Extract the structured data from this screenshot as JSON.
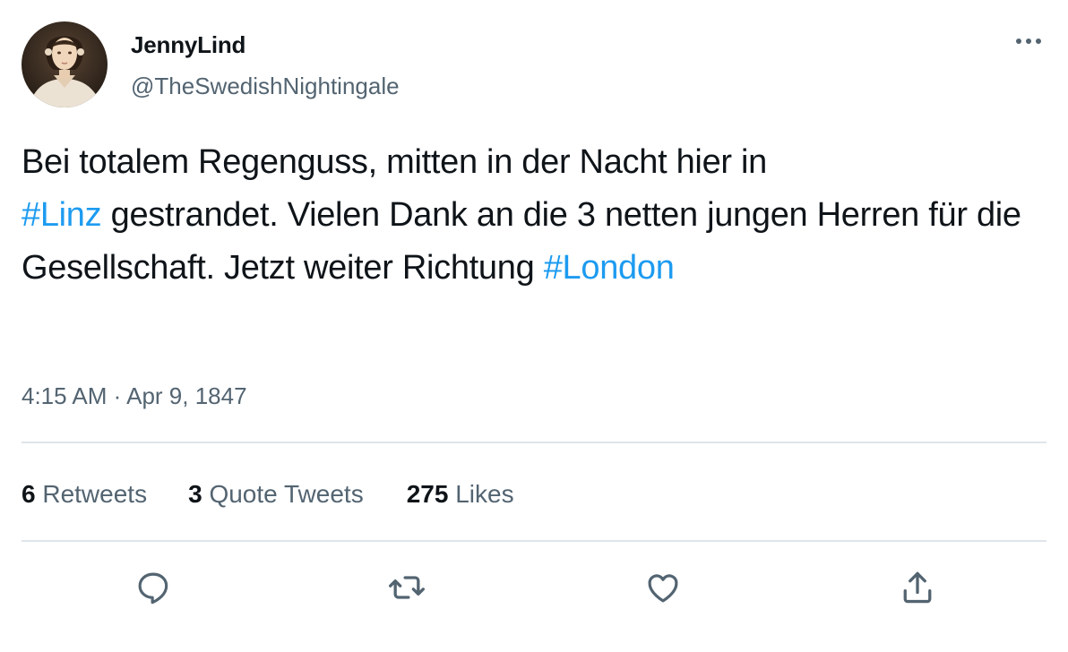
{
  "author": {
    "display_name": "JennyLind",
    "handle": "@TheSwedishNightingale",
    "avatar_icon": "portrait-avatar"
  },
  "tweet": {
    "text_parts": [
      "Bei totalem Regenguss, mitten in der Nacht hier in",
      "#Linz",
      "gestrandet. Vielen Dank an die 3 netten jungen Herren für die Gesellschaft. Jetzt weiter Richtung",
      "#London"
    ],
    "time": "4:15 AM",
    "separator": "·",
    "date": "Apr 9, 1847"
  },
  "stats": {
    "retweets_count": "6",
    "retweets_label": "Retweets",
    "quotes_count": "3",
    "quotes_label": "Quote Tweets",
    "likes_count": "275",
    "likes_label": "Likes"
  },
  "actions": [
    "reply-icon",
    "retweet-icon",
    "like-icon",
    "share-icon"
  ],
  "colors": {
    "text": "#0f1419",
    "secondary": "#536471",
    "link": "#1d9bf0",
    "divider": "#dfe5ea"
  }
}
